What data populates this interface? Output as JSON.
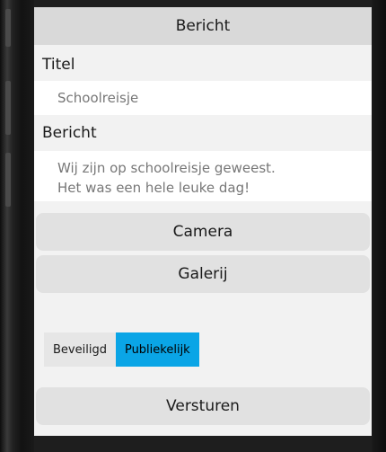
{
  "navbar": {
    "title": "Bericht"
  },
  "form": {
    "title_label": "Titel",
    "title_value": "Schoolreisje",
    "message_label": "Bericht",
    "message_value": "Wij zijn op schoolreisje geweest.\nHet was een hele leuke dag!"
  },
  "buttons": {
    "camera": "Camera",
    "gallery": "Galerij",
    "send": "Versturen"
  },
  "visibility": {
    "options": [
      "Beveiligd",
      "Publiekelijk"
    ],
    "selected": "Publiekelijk",
    "selected_color": "#0aa5e6"
  }
}
